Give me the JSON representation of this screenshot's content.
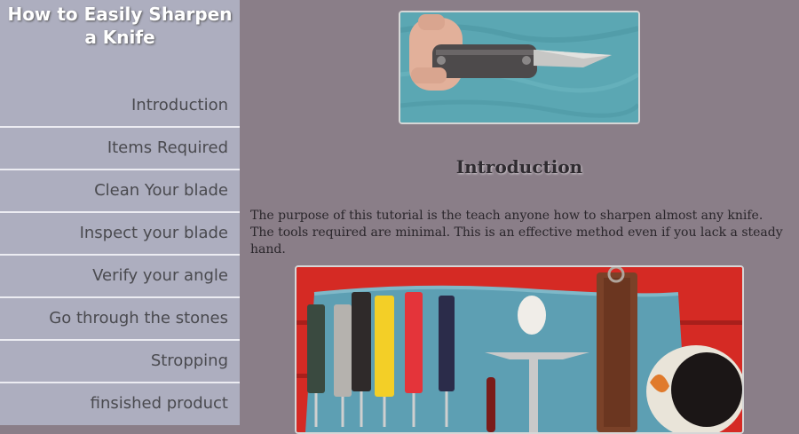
{
  "site_title": "How to Easily Sharpen a Knife",
  "nav": [
    {
      "label": "Introduction"
    },
    {
      "label": "Items Required"
    },
    {
      "label": "Clean Your blade"
    },
    {
      "label": "Inspect your blade"
    },
    {
      "label": "Verify your angle"
    },
    {
      "label": "Go through the stones"
    },
    {
      "label": "Stropping"
    },
    {
      "label": "finsished product"
    }
  ],
  "main": {
    "heading": "Introduction",
    "intro": "The purpose of this tutorial is the teach anyone how to sharpen almost any knife. The tools required are minimal. This is an effective method even if you lack a steady hand."
  },
  "images": {
    "top": "multi-tool knife held in hand on blue towel",
    "bottom": "sharpening stones, strop and tools laid out on blue towel"
  },
  "colors": {
    "sidebar_bg": "#adaebf",
    "main_bg": "#8a7e88",
    "divider": "#ececf2",
    "title_text": "#ffffff"
  }
}
